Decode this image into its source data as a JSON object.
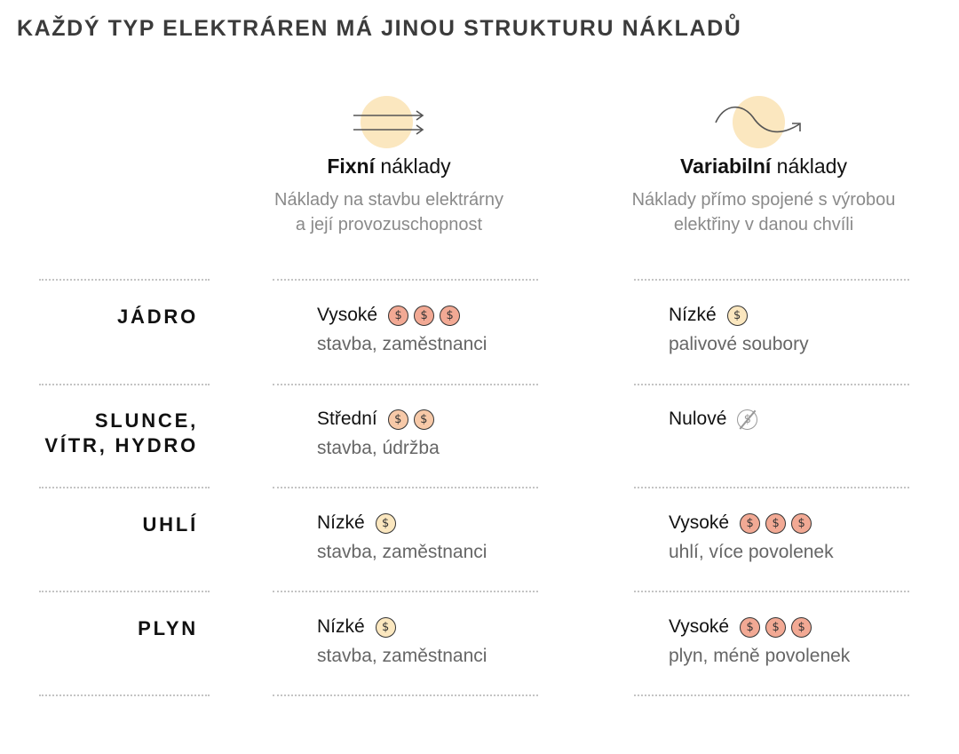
{
  "title": "KAŽDÝ TYP ELEKTRÁREN MÁ JINOU STRUKTURU NÁKLADŮ",
  "columns": {
    "fixed": {
      "heading_bold": "Fixní",
      "heading_rest": " náklady",
      "desc_line1": "Náklady na stavbu elektrárny",
      "desc_line2": "a její provozuschopnost",
      "icon": "parallel-arrows-icon"
    },
    "variable": {
      "heading_bold": "Variabilní",
      "heading_rest": " náklady",
      "desc_line1": "Náklady přímo spojené s výrobou",
      "desc_line2": "elektřiny v danou chvíli",
      "icon": "wave-arrow-icon"
    }
  },
  "coin_symbol": "$",
  "colors": {
    "coin_high": "#f2a994",
    "coin_mid": "#f7c9a8",
    "coin_low": "#fbe7bf",
    "sun": "#fbe7bf"
  },
  "rows": [
    {
      "label_line1": "JÁDRO",
      "label_line2": "",
      "fixed": {
        "level": "Vysoké",
        "coins": 3,
        "detail": "stavba, zaměstnanci"
      },
      "variable": {
        "level": "Nízké",
        "coins": 1,
        "detail": "palivové soubory"
      }
    },
    {
      "label_line1": "SLUNCE,",
      "label_line2": "VÍTR, HYDRO",
      "fixed": {
        "level": "Střední",
        "coins": 2,
        "detail": "stavba, údržba"
      },
      "variable": {
        "level": "Nulové",
        "coins": 0,
        "detail": ""
      }
    },
    {
      "label_line1": "UHLÍ",
      "label_line2": "",
      "fixed": {
        "level": "Nízké",
        "coins": 1,
        "detail": "stavba, zaměstnanci"
      },
      "variable": {
        "level": "Vysoké",
        "coins": 3,
        "detail": "uhlí, více povolenek"
      }
    },
    {
      "label_line1": "PLYN",
      "label_line2": "",
      "fixed": {
        "level": "Nízké",
        "coins": 1,
        "detail": "stavba, zaměstnanci"
      },
      "variable": {
        "level": "Vysoké",
        "coins": 3,
        "detail": "plyn, méně povolenek"
      }
    }
  ]
}
